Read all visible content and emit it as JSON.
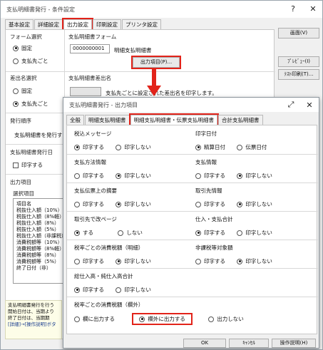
{
  "main": {
    "title": "支払明細書発行 - 条件設定",
    "tabs": [
      "基本設定",
      "詳細設定",
      "出力設定",
      "印刷設定",
      "プリンタ設定"
    ],
    "form_select": {
      "label": "フォーム選択",
      "options": [
        "固定",
        "支払先ごと"
      ],
      "selected": "固定"
    },
    "payment_form": {
      "label": "支払明細書フォーム",
      "code": "0000000001",
      "name": "明細支払明細書",
      "output_items_button": "出力項目(P)..."
    },
    "sender_select": {
      "label": "差出名選択",
      "options": [
        "固定",
        "支払先ごと"
      ],
      "selected": "支払先ごと"
    },
    "sender_name": {
      "label": "支払明細書差出名",
      "text": "支払先ごとに設定された差出名を印字します。"
    },
    "issue_order": {
      "label": "発行順序",
      "text": "支払明細書を発行す"
    },
    "issue_date": {
      "label": "支払明細書発行日",
      "checkbox_label": "印字する"
    },
    "output_items": {
      "label": "出力項目",
      "sub_label": "選択項目",
      "header": "項目名",
      "rows": [
        "税抜仕入額（10%）",
        "税抜仕入額（8%軽）",
        "税抜仕入額（8%）",
        "税抜仕入額（5%）",
        "税抜仕入額（非課税）",
        "消費税額等（10%）",
        "消費税額等（8%軽）",
        "消費税額等（8%）",
        "消費税額等（5%）",
        "終了日付（非）"
      ]
    },
    "bottom_note": [
      "支払明細書発行を行う",
      "開始日付は、当期より",
      "終了日付は、当期期",
      "[詳細]→[操作説明]ボタ"
    ],
    "right_buttons": [
      "画面(V)",
      "ﾌﾟﾚﾋﾞｭｰ(I)",
      "ﾃｽﾄ印刷(T)..."
    ]
  },
  "dialog": {
    "title": "支払明細書発行 - 出力項目",
    "tabs": [
      "全般",
      "明細支払明細書",
      "明細支払明細書・伝票支払明細書",
      "合計支払明細書"
    ],
    "groups": [
      {
        "label": "税込メッセージ",
        "options": [
          "印字する",
          "印字しない"
        ],
        "selected": "印字する"
      },
      {
        "label": "印字日付",
        "options": [
          "精算日付",
          "伝票日付"
        ],
        "selected": "精算日付"
      },
      {
        "label": "支払方法情報",
        "options": [
          "印字する",
          "印字しない"
        ],
        "selected": "印字しない"
      },
      {
        "label": "支払情報",
        "options": [
          "印字する",
          "印字しない"
        ],
        "selected": "印字しない"
      },
      {
        "label": "支払伝票上の摘要",
        "options": [
          "印字する",
          "印字しない"
        ],
        "selected": "印字しない"
      },
      {
        "label": "取引先情報",
        "options": [
          "印字する",
          "印字しない"
        ],
        "selected": "印字しない"
      },
      {
        "label": "取引先で改ページ",
        "options": [
          "する",
          "しない"
        ],
        "selected": "する"
      },
      {
        "label": "仕入・支払合計",
        "options": [
          "印字する",
          "印字しない"
        ],
        "selected": "印字する"
      },
      {
        "label": "税率ごとの消費税額（明細）",
        "options": [
          "印字する",
          "印字しない"
        ],
        "selected": "印字しない"
      },
      {
        "label": "非課税等対象額",
        "options": [
          "印字する",
          "印字しない"
        ],
        "selected": "印字しない"
      },
      {
        "label": "総仕入高・純仕入高合計",
        "options": [
          "印字する",
          "印字しない"
        ],
        "selected": "印字する"
      }
    ],
    "tax_group": {
      "label": "税率ごとの消費税額（欄外）",
      "options": [
        "欄に出力する",
        "欄外に出力する",
        "出力しない"
      ],
      "selected": "欄外に出力する"
    },
    "footer_buttons": [
      "OK",
      "ｷｬﾝｾﾙ",
      "操作説明(H)"
    ]
  },
  "colors": {
    "highlight": "#e2231a",
    "arrow": "#e2231a"
  }
}
